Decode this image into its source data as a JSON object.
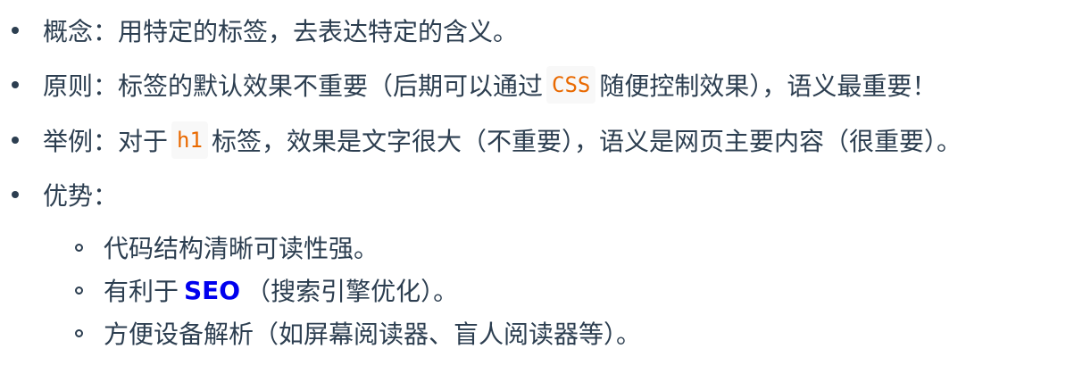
{
  "items": [
    {
      "label": "概念：",
      "text": "用特定的标签，去表达特定的含义。"
    },
    {
      "label": "原则：",
      "before": "标签的默认效果不重要（后期可以通过",
      "code": "CSS",
      "after": "随便控制效果），语义最重要！"
    },
    {
      "label": "举例：",
      "before": "对于",
      "code": "h1",
      "after": "标签，效果是文字很大（不重要），语义是网页主要内容（很重要）。"
    },
    {
      "label": "优势：",
      "subitems": [
        {
          "text": "代码结构清晰可读性强。"
        },
        {
          "before": "有利于",
          "strong": "SEO",
          "after": "（搜索引擎优化）。"
        },
        {
          "text": "方便设备解析（如屏幕阅读器、盲人阅读器等）。"
        }
      ]
    }
  ]
}
